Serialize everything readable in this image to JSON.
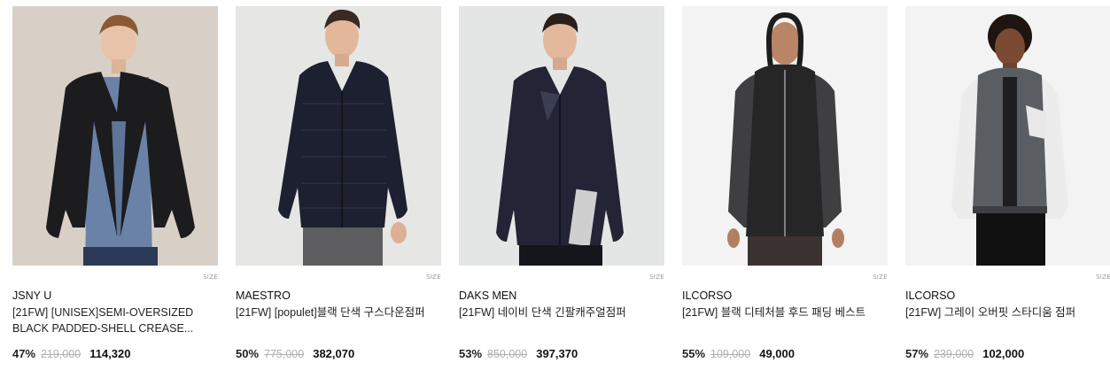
{
  "products": [
    {
      "brand": "JSNY U",
      "title": "[21FW] [UNISEX]SEMI-OVERSIZED BLACK PADDED-SHELL CREASE...",
      "discount": "47%",
      "original_price": "219,000",
      "sale_price": "114,320",
      "size_label": "SIZE",
      "bg": "#d8d0c6",
      "garment": "#1c1c1e"
    },
    {
      "brand": "MAESTRO",
      "title": "[21FW] [populet]블랙 단색 구스다운점퍼",
      "discount": "50%",
      "original_price": "775,000",
      "sale_price": "382,070",
      "size_label": "SIZE",
      "bg": "#e6e6e4",
      "garment": "#1d2030"
    },
    {
      "brand": "DAKS MEN",
      "title": "[21FW] 네이비 단색 긴팔캐주얼점퍼",
      "discount": "53%",
      "original_price": "850,000",
      "sale_price": "397,370",
      "size_label": "SIZE",
      "bg": "#e4e6e5",
      "garment": "#232536"
    },
    {
      "brand": "ILCORSO",
      "title": "[21FW] 블랙 디테처블 후드 패딩 베스트",
      "discount": "55%",
      "original_price": "109,000",
      "sale_price": "49,000",
      "size_label": "SIZE",
      "bg": "#f3f3f3",
      "garment": "#262626"
    },
    {
      "brand": "ILCORSO",
      "title": "[21FW] 그레이 오버핏 스타디움 점퍼",
      "discount": "57%",
      "original_price": "239,000",
      "sale_price": "102,000",
      "size_label": "SIZE",
      "bg": "#f3f3f3",
      "garment": "#5a5d62"
    }
  ]
}
